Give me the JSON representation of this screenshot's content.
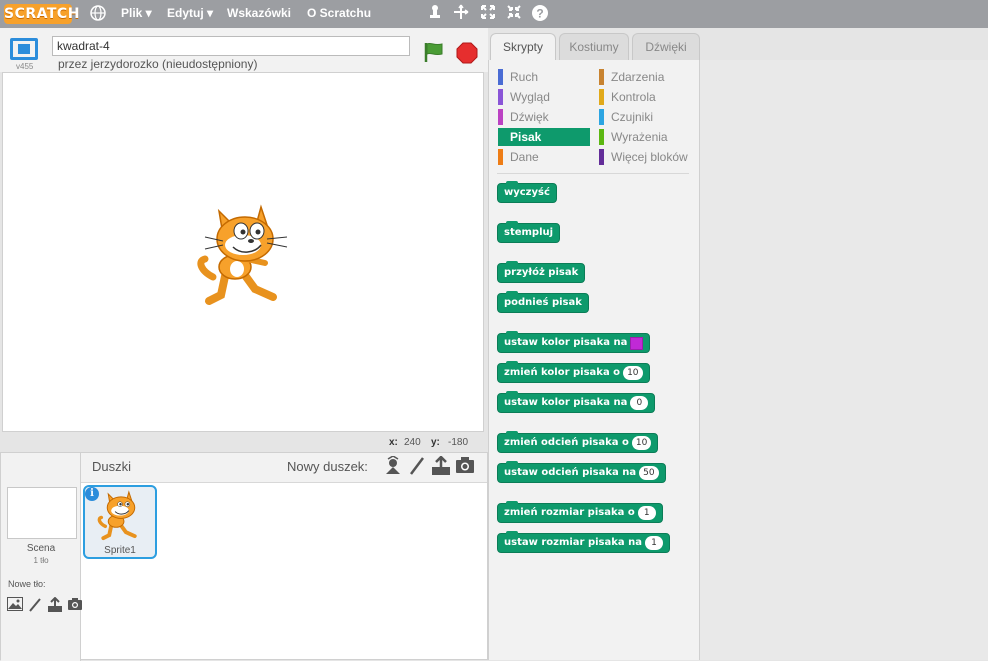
{
  "app": {
    "logo": "SCRATCH"
  },
  "menu": {
    "items": [
      "Plik ▾",
      "Edytuj ▾",
      "Wskazówki",
      "O Scratchu"
    ]
  },
  "project": {
    "title": "kwadrat-4",
    "author": "przez jerzydorozko (nieudostępniony)",
    "version": "v455"
  },
  "stage": {
    "x_label": "x:",
    "x_value": "240",
    "y_label": "y:",
    "y_value": "-180"
  },
  "sprites": {
    "title": "Duszki",
    "new_sprite_label": "Nowy duszek:",
    "scene_label": "Scena",
    "scene_sub": "1 tło",
    "new_backdrop_label": "Nowe tło:",
    "sprite_name": "Sprite1"
  },
  "tabs": [
    "Skrypty",
    "Kostiumy",
    "Dźwięki"
  ],
  "categories": [
    {
      "label": "Ruch",
      "color": "#4a6cd4"
    },
    {
      "label": "Zdarzenia",
      "color": "#c88330"
    },
    {
      "label": "Wygląd",
      "color": "#8a55d7"
    },
    {
      "label": "Kontrola",
      "color": "#e1a91a"
    },
    {
      "label": "Dźwięk",
      "color": "#bb42c3"
    },
    {
      "label": "Czujniki",
      "color": "#2ca5e2"
    },
    {
      "label": "Pisak",
      "color": "#0e9a6c"
    },
    {
      "label": "Wyrażenia",
      "color": "#5cb712"
    },
    {
      "label": "Dane",
      "color": "#ee7d16"
    },
    {
      "label": "Więcej bloków",
      "color": "#632d99"
    }
  ],
  "active_category": "Pisak",
  "blocks": [
    {
      "text": "wyczyść"
    },
    {
      "text": "stempluj"
    },
    {
      "text": "przyłóż pisak"
    },
    {
      "text": "podnieś pisak"
    },
    {
      "text": "ustaw kolor pisaka na",
      "color_swatch": "#c029d6"
    },
    {
      "text": "zmień kolor pisaka o",
      "value": "10"
    },
    {
      "text": "ustaw kolor pisaka na",
      "value": "0"
    },
    {
      "text": "zmień odcień pisaka o",
      "value": "10"
    },
    {
      "text": "ustaw odcień pisaka na",
      "value": "50"
    },
    {
      "text": "zmień rozmiar pisaka o",
      "value": "1"
    },
    {
      "text": "ustaw rozmiar pisaka na",
      "value": "1"
    }
  ]
}
